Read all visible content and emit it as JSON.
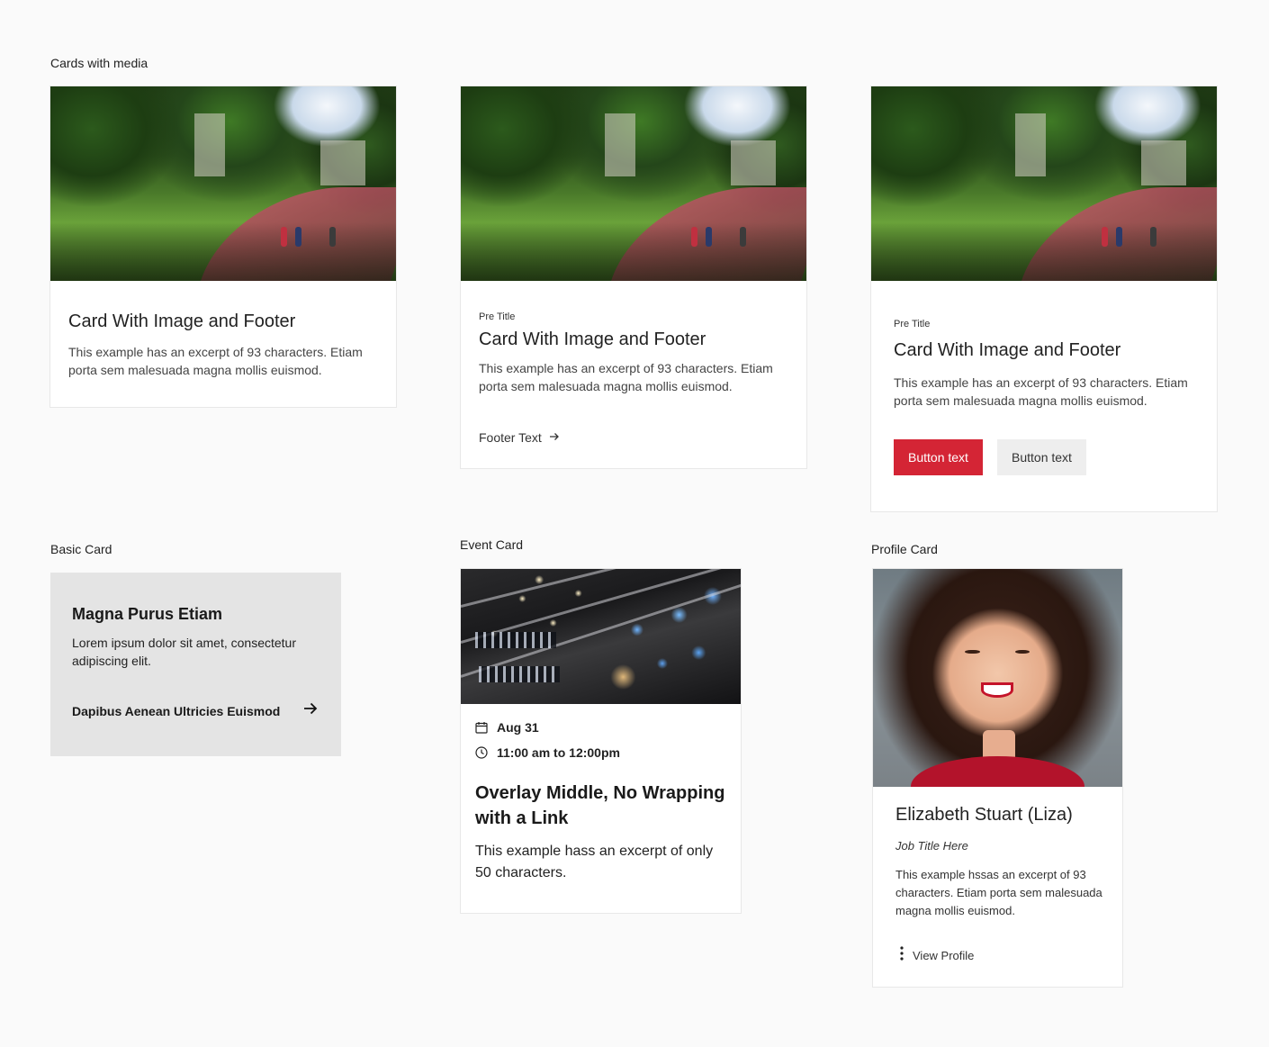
{
  "sections": {
    "cards_with_media": "Cards with media",
    "basic_card": "Basic Card",
    "event_card": "Event Card",
    "profile_card": "Profile Card"
  },
  "media_card_1": {
    "title": "Card With Image and Footer",
    "excerpt": "This example has an excerpt of 93 characters. Etiam porta sem malesuada magna mollis euismod."
  },
  "media_card_2": {
    "pretitle": "Pre Title",
    "title": "Card With Image and Footer",
    "excerpt": "This example has an excerpt of 93 characters. Etiam porta sem malesuada magna mollis euismod.",
    "footer_text": "Footer Text",
    "footer_icon": "arrow-right-icon"
  },
  "media_card_3": {
    "pretitle": "Pre Title",
    "title": "Card With Image and Footer",
    "excerpt": "This example has an excerpt of 93 characters. Etiam porta sem malesuada magna mollis euismod.",
    "primary_button": "Button text",
    "secondary_button": "Button text"
  },
  "basic_card": {
    "title": "Magna Purus Etiam",
    "text": "Lorem ipsum dolor sit amet, consectetur adipiscing elit.",
    "link": "Dapibus Aenean Ultricies Euismod",
    "link_icon": "arrow-right-icon"
  },
  "event_card": {
    "date": "Aug 31",
    "date_icon": "calendar-icon",
    "time": "11:00 am to 12:00pm",
    "time_icon": "clock-icon",
    "title": "Overlay Middle, No Wrapping with a Link",
    "excerpt": "This example hass an excerpt of only 50 characters."
  },
  "profile_card": {
    "name": "Elizabeth Stuart (Liza)",
    "job_title": "Job Title Here",
    "excerpt": "This example hssas an excerpt of 93 characters. Etiam porta sem malesuada magna mollis euismod.",
    "menu_icon": "kebab-menu-icon",
    "link": "View Profile"
  },
  "colors": {
    "primary": "#d42535",
    "page_bg": "#fafafa",
    "basic_card_bg": "#e4e4e4"
  }
}
